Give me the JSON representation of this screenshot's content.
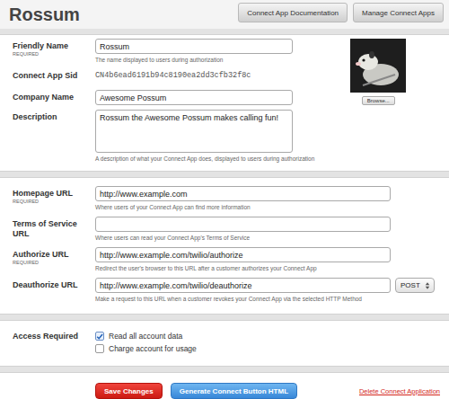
{
  "header": {
    "title": "Rossum",
    "buttons": [
      "Connect App Documentation",
      "Manage Connect Apps"
    ]
  },
  "details": {
    "fields": [
      {
        "kind": "input",
        "label": "Friendly Name",
        "note": "REQUIRED",
        "value": "Rossum",
        "hint": "The name displayed to users during authorization"
      },
      {
        "kind": "sid",
        "label": "Connect App Sid",
        "value": "CN4b6ead6191b94c8190ea2dd3cfb32f8c"
      },
      {
        "kind": "input",
        "label": "Company Name",
        "value": "Awesome Possum"
      },
      {
        "kind": "textarea",
        "label": "Description",
        "value": "Rossum the Awesome Possum makes calling fun!",
        "hint": "A description of what your Connect App does, displayed to users during authorization"
      }
    ],
    "photo": {
      "button": "Browse..."
    }
  },
  "urls": {
    "fields": [
      {
        "kind": "input",
        "label": "Homepage URL",
        "note": "REQUIRED",
        "value": "http://www.example.com",
        "hint": "Where users of your Connect App can find more information"
      },
      {
        "kind": "input",
        "label": "Terms of Service URL",
        "value": "",
        "hint": "Where users can read your Connect App's Terms of Service"
      },
      {
        "kind": "input",
        "label": "Authorize URL",
        "note": "REQUIRED",
        "value": "http://www.example.com/twilio/authorize",
        "hint": "Redirect the user's browser to this URL after a customer authorizes your Connect App"
      },
      {
        "kind": "url-method",
        "label": "Deauthorize URL",
        "value": "http://www.example.com/twilio/deauthorize",
        "method": "POST",
        "hint": "Make a request to this URL when a customer revokes your Connect App via the selected HTTP Method"
      }
    ]
  },
  "access": {
    "label": "Access Required",
    "options": [
      {
        "label": "Read all account data",
        "checked": true
      },
      {
        "label": "Charge account for usage",
        "checked": false
      }
    ]
  },
  "footer": {
    "save": "Save Changes",
    "generate": "Generate Connect Button HTML",
    "delete": "Delete Connect Application"
  }
}
